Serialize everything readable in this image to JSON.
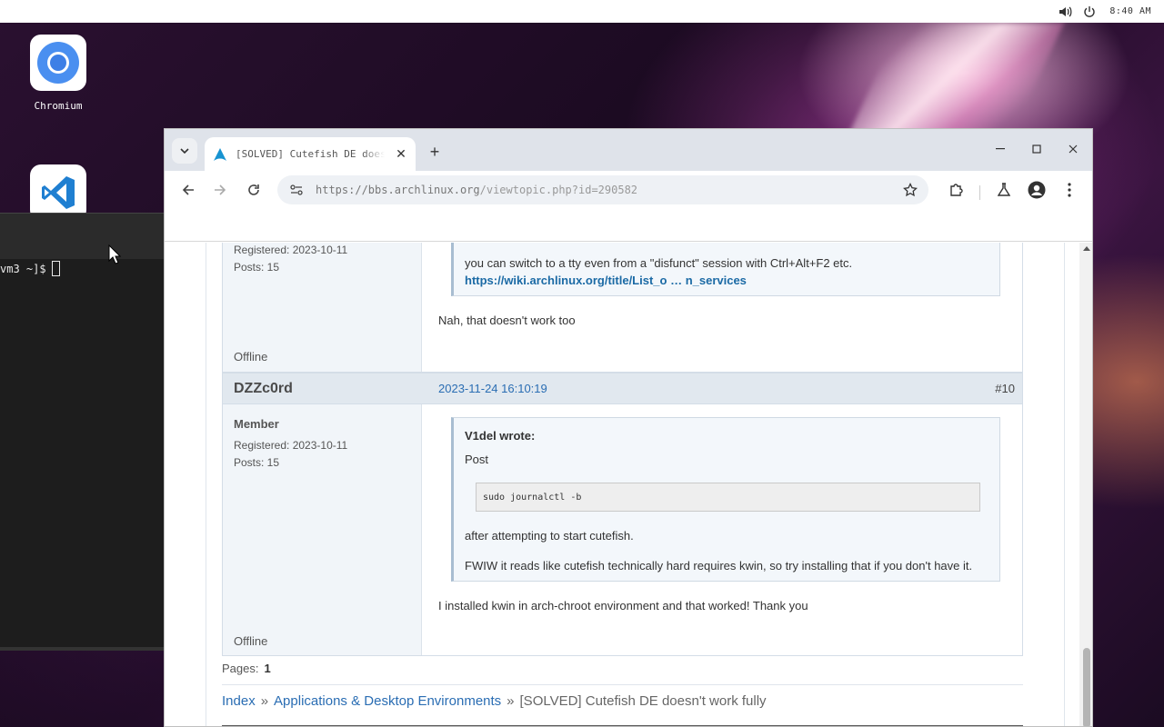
{
  "system": {
    "clock": "8:40 AM"
  },
  "desktop": {
    "icons": [
      {
        "label": "Chromium"
      },
      {
        "label": ""
      }
    ]
  },
  "terminal": {
    "prompt": "vm3 ~]$"
  },
  "browser": {
    "tab": {
      "title": "[SOLVED] Cutefish DE doesn't work fully"
    },
    "address": {
      "scheme_host": "https://bbs.archlinux.org",
      "path": "/viewtopic.php?id=290582"
    }
  },
  "page": {
    "post9": {
      "registered": "Registered: 2023-10-11",
      "posts": "Posts: 15",
      "quote_text": "you can switch to a tty even from a \"disfunct\" session with Ctrl+Alt+F2 etc.",
      "quote_link": "https://wiki.archlinux.org/title/List_o … n_services",
      "reply": "Nah, that doesn't work too",
      "status": "Offline"
    },
    "post10": {
      "author": "DZZc0rd",
      "date": "2023-11-24 16:10:19",
      "number": "#10",
      "role": "Member",
      "registered": "Registered: 2023-10-11",
      "posts": "Posts: 15",
      "quote_author": "V1del wrote:",
      "quote_line1": "Post",
      "code": "sudo journalctl -b",
      "quote_line2": "after attempting to start cutefish.",
      "quote_line3": "FWIW it reads like cutefish technically hard requires kwin, so try installing that if you don't have it.",
      "reply": "I installed kwin in arch-chroot environment and that worked! Thank you",
      "status": "Offline"
    },
    "pagination": {
      "label": "Pages:",
      "current": "1"
    },
    "breadcrumb": {
      "index": "Index",
      "forum": "Applications & Desktop Environments",
      "topic": "[SOLVED] Cutefish DE doesn't work fully"
    }
  }
}
